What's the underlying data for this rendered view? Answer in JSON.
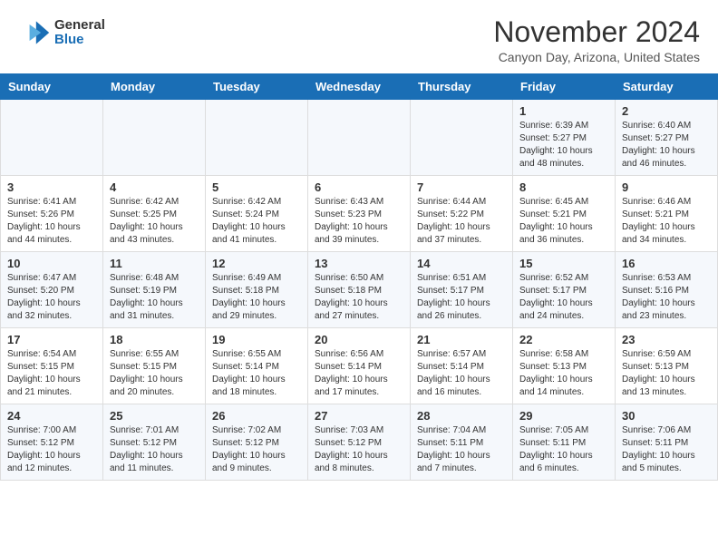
{
  "logo": {
    "line1": "General",
    "line2": "Blue"
  },
  "title": "November 2024",
  "subtitle": "Canyon Day, Arizona, United States",
  "weekdays": [
    "Sunday",
    "Monday",
    "Tuesday",
    "Wednesday",
    "Thursday",
    "Friday",
    "Saturday"
  ],
  "weeks": [
    [
      {
        "day": "",
        "info": ""
      },
      {
        "day": "",
        "info": ""
      },
      {
        "day": "",
        "info": ""
      },
      {
        "day": "",
        "info": ""
      },
      {
        "day": "",
        "info": ""
      },
      {
        "day": "1",
        "info": "Sunrise: 6:39 AM\nSunset: 5:27 PM\nDaylight: 10 hours\nand 48 minutes."
      },
      {
        "day": "2",
        "info": "Sunrise: 6:40 AM\nSunset: 5:27 PM\nDaylight: 10 hours\nand 46 minutes."
      }
    ],
    [
      {
        "day": "3",
        "info": "Sunrise: 6:41 AM\nSunset: 5:26 PM\nDaylight: 10 hours\nand 44 minutes."
      },
      {
        "day": "4",
        "info": "Sunrise: 6:42 AM\nSunset: 5:25 PM\nDaylight: 10 hours\nand 43 minutes."
      },
      {
        "day": "5",
        "info": "Sunrise: 6:42 AM\nSunset: 5:24 PM\nDaylight: 10 hours\nand 41 minutes."
      },
      {
        "day": "6",
        "info": "Sunrise: 6:43 AM\nSunset: 5:23 PM\nDaylight: 10 hours\nand 39 minutes."
      },
      {
        "day": "7",
        "info": "Sunrise: 6:44 AM\nSunset: 5:22 PM\nDaylight: 10 hours\nand 37 minutes."
      },
      {
        "day": "8",
        "info": "Sunrise: 6:45 AM\nSunset: 5:21 PM\nDaylight: 10 hours\nand 36 minutes."
      },
      {
        "day": "9",
        "info": "Sunrise: 6:46 AM\nSunset: 5:21 PM\nDaylight: 10 hours\nand 34 minutes."
      }
    ],
    [
      {
        "day": "10",
        "info": "Sunrise: 6:47 AM\nSunset: 5:20 PM\nDaylight: 10 hours\nand 32 minutes."
      },
      {
        "day": "11",
        "info": "Sunrise: 6:48 AM\nSunset: 5:19 PM\nDaylight: 10 hours\nand 31 minutes."
      },
      {
        "day": "12",
        "info": "Sunrise: 6:49 AM\nSunset: 5:18 PM\nDaylight: 10 hours\nand 29 minutes."
      },
      {
        "day": "13",
        "info": "Sunrise: 6:50 AM\nSunset: 5:18 PM\nDaylight: 10 hours\nand 27 minutes."
      },
      {
        "day": "14",
        "info": "Sunrise: 6:51 AM\nSunset: 5:17 PM\nDaylight: 10 hours\nand 26 minutes."
      },
      {
        "day": "15",
        "info": "Sunrise: 6:52 AM\nSunset: 5:17 PM\nDaylight: 10 hours\nand 24 minutes."
      },
      {
        "day": "16",
        "info": "Sunrise: 6:53 AM\nSunset: 5:16 PM\nDaylight: 10 hours\nand 23 minutes."
      }
    ],
    [
      {
        "day": "17",
        "info": "Sunrise: 6:54 AM\nSunset: 5:15 PM\nDaylight: 10 hours\nand 21 minutes."
      },
      {
        "day": "18",
        "info": "Sunrise: 6:55 AM\nSunset: 5:15 PM\nDaylight: 10 hours\nand 20 minutes."
      },
      {
        "day": "19",
        "info": "Sunrise: 6:55 AM\nSunset: 5:14 PM\nDaylight: 10 hours\nand 18 minutes."
      },
      {
        "day": "20",
        "info": "Sunrise: 6:56 AM\nSunset: 5:14 PM\nDaylight: 10 hours\nand 17 minutes."
      },
      {
        "day": "21",
        "info": "Sunrise: 6:57 AM\nSunset: 5:14 PM\nDaylight: 10 hours\nand 16 minutes."
      },
      {
        "day": "22",
        "info": "Sunrise: 6:58 AM\nSunset: 5:13 PM\nDaylight: 10 hours\nand 14 minutes."
      },
      {
        "day": "23",
        "info": "Sunrise: 6:59 AM\nSunset: 5:13 PM\nDaylight: 10 hours\nand 13 minutes."
      }
    ],
    [
      {
        "day": "24",
        "info": "Sunrise: 7:00 AM\nSunset: 5:12 PM\nDaylight: 10 hours\nand 12 minutes."
      },
      {
        "day": "25",
        "info": "Sunrise: 7:01 AM\nSunset: 5:12 PM\nDaylight: 10 hours\nand 11 minutes."
      },
      {
        "day": "26",
        "info": "Sunrise: 7:02 AM\nSunset: 5:12 PM\nDaylight: 10 hours\nand 9 minutes."
      },
      {
        "day": "27",
        "info": "Sunrise: 7:03 AM\nSunset: 5:12 PM\nDaylight: 10 hours\nand 8 minutes."
      },
      {
        "day": "28",
        "info": "Sunrise: 7:04 AM\nSunset: 5:11 PM\nDaylight: 10 hours\nand 7 minutes."
      },
      {
        "day": "29",
        "info": "Sunrise: 7:05 AM\nSunset: 5:11 PM\nDaylight: 10 hours\nand 6 minutes."
      },
      {
        "day": "30",
        "info": "Sunrise: 7:06 AM\nSunset: 5:11 PM\nDaylight: 10 hours\nand 5 minutes."
      }
    ]
  ]
}
